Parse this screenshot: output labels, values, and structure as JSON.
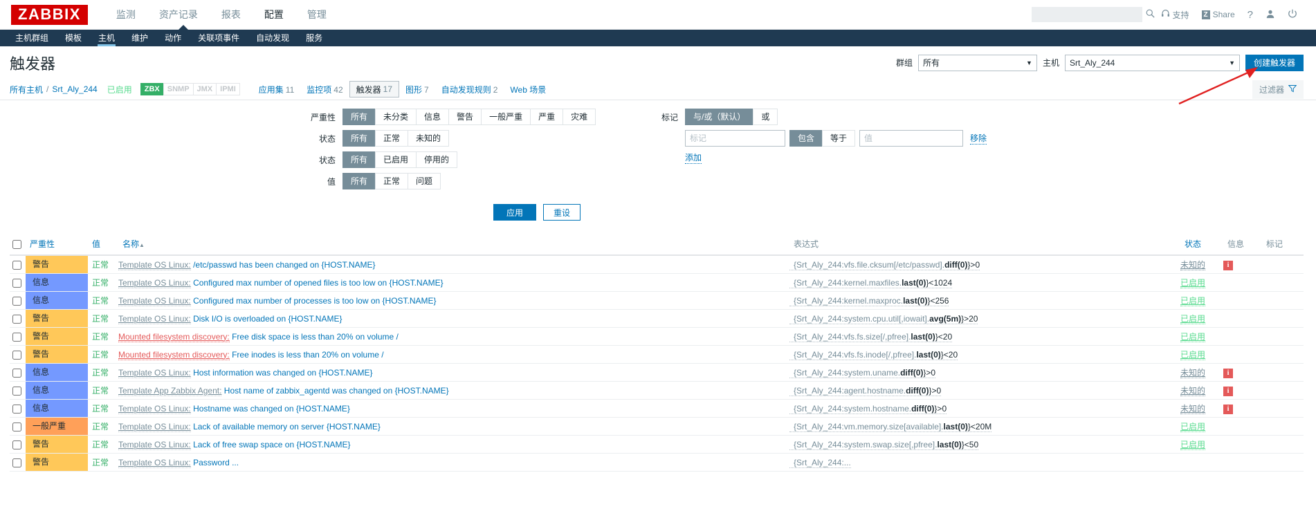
{
  "header": {
    "logo": "ZABBIX",
    "nav": [
      {
        "label": "监测",
        "active": false
      },
      {
        "label": "资产记录",
        "active": false
      },
      {
        "label": "报表",
        "active": false
      },
      {
        "label": "配置",
        "active": true
      },
      {
        "label": "管理",
        "active": false
      }
    ],
    "search_placeholder": "",
    "search_value": "",
    "support_label": "支持",
    "share_label": "Share",
    "share_badge": "Z",
    "help_label": "?",
    "user_label": "",
    "signout_label": ""
  },
  "subnav": {
    "items": [
      {
        "label": "主机群组",
        "active": false
      },
      {
        "label": "模板",
        "active": false
      },
      {
        "label": "主机",
        "active": true
      },
      {
        "label": "维护",
        "active": false
      },
      {
        "label": "动作",
        "active": false
      },
      {
        "label": "关联项事件",
        "active": false
      },
      {
        "label": "自动发现",
        "active": false
      },
      {
        "label": "服务",
        "active": false
      }
    ]
  },
  "page": {
    "title": "触发器",
    "group_label": "群组",
    "group_value": "所有",
    "host_label": "主机",
    "host_value": "Srt_Aly_244",
    "create_button": "创建触发器"
  },
  "breadcrumb": {
    "all_hosts": "所有主机",
    "separator": "/",
    "host": "Srt_Aly_244",
    "status": "已启用",
    "interfaces": [
      {
        "label": "ZBX",
        "on": true
      },
      {
        "label": "SNMP",
        "on": false
      },
      {
        "label": "JMX",
        "on": false
      },
      {
        "label": "IPMI",
        "on": false
      }
    ],
    "object_tabs": [
      {
        "label": "应用集",
        "count": "11",
        "selected": false
      },
      {
        "label": "监控项",
        "count": "42",
        "selected": false
      },
      {
        "label": "触发器",
        "count": "17",
        "selected": true
      },
      {
        "label": "图形",
        "count": "7",
        "selected": false
      },
      {
        "label": "自动发现规则",
        "count": "2",
        "selected": false
      },
      {
        "label": "Web 场景",
        "count": "",
        "selected": false
      }
    ],
    "filter_tab": "过滤器"
  },
  "filter": {
    "rows": [
      {
        "label": "严重性",
        "options": [
          {
            "label": "所有",
            "on": true
          },
          {
            "label": "未分类",
            "on": false
          },
          {
            "label": "信息",
            "on": false
          },
          {
            "label": "警告",
            "on": false
          },
          {
            "label": "一般严重",
            "on": false
          },
          {
            "label": "严重",
            "on": false
          },
          {
            "label": "灾难",
            "on": false
          }
        ]
      },
      {
        "label": "状态",
        "options": [
          {
            "label": "所有",
            "on": true
          },
          {
            "label": "正常",
            "on": false
          },
          {
            "label": "未知的",
            "on": false
          }
        ]
      },
      {
        "label": "状态",
        "options": [
          {
            "label": "所有",
            "on": true
          },
          {
            "label": "已启用",
            "on": false
          },
          {
            "label": "停用的",
            "on": false
          }
        ]
      },
      {
        "label": "值",
        "options": [
          {
            "label": "所有",
            "on": true
          },
          {
            "label": "正常",
            "on": false
          },
          {
            "label": "问题",
            "on": false
          }
        ]
      }
    ],
    "tag_label": "标记",
    "tag_modes": [
      {
        "label": "与/或（默认）",
        "on": true
      },
      {
        "label": "或",
        "on": false
      }
    ],
    "tag_name_placeholder": "标记",
    "tag_name_value": "",
    "tag_operators": [
      {
        "label": "包含",
        "on": true
      },
      {
        "label": "等于",
        "on": false
      }
    ],
    "tag_value_placeholder": "值",
    "tag_value_value": "",
    "remove_label": "移除",
    "add_label": "添加",
    "apply_label": "应用",
    "reset_label": "重设"
  },
  "table": {
    "columns": {
      "severity": "严重性",
      "value": "值",
      "name": "名称",
      "sort_arrow": "▲",
      "expression": "表达式",
      "status": "状态",
      "info": "信息",
      "tags": "标记"
    },
    "rows": [
      {
        "severity": "警告",
        "severity_class": "sev-warning",
        "value": "正常",
        "template": "Template OS Linux:",
        "template_red": false,
        "name": "/etc/passwd has been changed on {HOST.NAME}",
        "expr_prefix": "{Srt_Aly_244:vfs.file.cksum[/etc/passwd].",
        "expr_func": "diff(0)",
        "expr_tail": "}>0",
        "status": "未知的",
        "status_class": "st-unknown",
        "info": "i"
      },
      {
        "severity": "信息",
        "severity_class": "sev-info",
        "value": "正常",
        "template": "Template OS Linux:",
        "template_red": false,
        "name": "Configured max number of opened files is too low on {HOST.NAME}",
        "expr_prefix": "{Srt_Aly_244:kernel.maxfiles.",
        "expr_func": "last(0)",
        "expr_tail": "}<1024",
        "status": "已启用",
        "status_class": "st-enabled",
        "info": ""
      },
      {
        "severity": "信息",
        "severity_class": "sev-info",
        "value": "正常",
        "template": "Template OS Linux:",
        "template_red": false,
        "name": "Configured max number of processes is too low on {HOST.NAME}",
        "expr_prefix": "{Srt_Aly_244:kernel.maxproc.",
        "expr_func": "last(0)",
        "expr_tail": "}<256",
        "status": "已启用",
        "status_class": "st-enabled",
        "info": ""
      },
      {
        "severity": "警告",
        "severity_class": "sev-warning",
        "value": "正常",
        "template": "Template OS Linux:",
        "template_red": false,
        "name": "Disk I/O is overloaded on {HOST.NAME}",
        "expr_prefix": "{Srt_Aly_244:system.cpu.util[,iowait].",
        "expr_func": "avg(5m)",
        "expr_tail": "}>20",
        "status": "已启用",
        "status_class": "st-enabled",
        "info": ""
      },
      {
        "severity": "警告",
        "severity_class": "sev-warning",
        "value": "正常",
        "template": "Mounted filesystem discovery:",
        "template_red": true,
        "name": "Free disk space is less than 20% on volume /",
        "expr_prefix": "{Srt_Aly_244:vfs.fs.size[/,pfree].",
        "expr_func": "last(0)",
        "expr_tail": "}<20",
        "status": "已启用",
        "status_class": "st-enabled",
        "info": ""
      },
      {
        "severity": "警告",
        "severity_class": "sev-warning",
        "value": "正常",
        "template": "Mounted filesystem discovery:",
        "template_red": true,
        "name": "Free inodes is less than 20% on volume /",
        "expr_prefix": "{Srt_Aly_244:vfs.fs.inode[/,pfree].",
        "expr_func": "last(0)",
        "expr_tail": "}<20",
        "status": "已启用",
        "status_class": "st-enabled",
        "info": ""
      },
      {
        "severity": "信息",
        "severity_class": "sev-info",
        "value": "正常",
        "template": "Template OS Linux:",
        "template_red": false,
        "name": "Host information was changed on {HOST.NAME}",
        "expr_prefix": "{Srt_Aly_244:system.uname.",
        "expr_func": "diff(0)",
        "expr_tail": "}>0",
        "status": "未知的",
        "status_class": "st-unknown",
        "info": "i"
      },
      {
        "severity": "信息",
        "severity_class": "sev-info",
        "value": "正常",
        "template": "Template App Zabbix Agent:",
        "template_red": false,
        "name": "Host name of zabbix_agentd was changed on {HOST.NAME}",
        "expr_prefix": "{Srt_Aly_244:agent.hostname.",
        "expr_func": "diff(0)",
        "expr_tail": "}>0",
        "status": "未知的",
        "status_class": "st-unknown",
        "info": "i"
      },
      {
        "severity": "信息",
        "severity_class": "sev-info",
        "value": "正常",
        "template": "Template OS Linux:",
        "template_red": false,
        "name": "Hostname was changed on {HOST.NAME}",
        "expr_prefix": "{Srt_Aly_244:system.hostname.",
        "expr_func": "diff(0)",
        "expr_tail": "}>0",
        "status": "未知的",
        "status_class": "st-unknown",
        "info": "i"
      },
      {
        "severity": "一般严重",
        "severity_class": "sev-average",
        "value": "正常",
        "template": "Template OS Linux:",
        "template_red": false,
        "name": "Lack of available memory on server {HOST.NAME}",
        "expr_prefix": "{Srt_Aly_244:vm.memory.size[available].",
        "expr_func": "last(0)",
        "expr_tail": "}<20M",
        "status": "已启用",
        "status_class": "st-enabled",
        "info": ""
      },
      {
        "severity": "警告",
        "severity_class": "sev-warning",
        "value": "正常",
        "template": "Template OS Linux:",
        "template_red": false,
        "name": "Lack of free swap space on {HOST.NAME}",
        "expr_prefix": "{Srt_Aly_244:system.swap.size[,pfree].",
        "expr_func": "last(0)",
        "expr_tail": "}<50",
        "status": "已启用",
        "status_class": "st-enabled",
        "info": ""
      },
      {
        "severity": "警告",
        "severity_class": "sev-warning",
        "value": "正常",
        "template": "Template OS Linux:",
        "template_red": false,
        "name": "Password ...",
        "expr_prefix": "{Srt_Aly_244:...",
        "expr_func": "",
        "expr_tail": "",
        "status": "",
        "status_class": "st-enabled",
        "info": ""
      }
    ]
  }
}
